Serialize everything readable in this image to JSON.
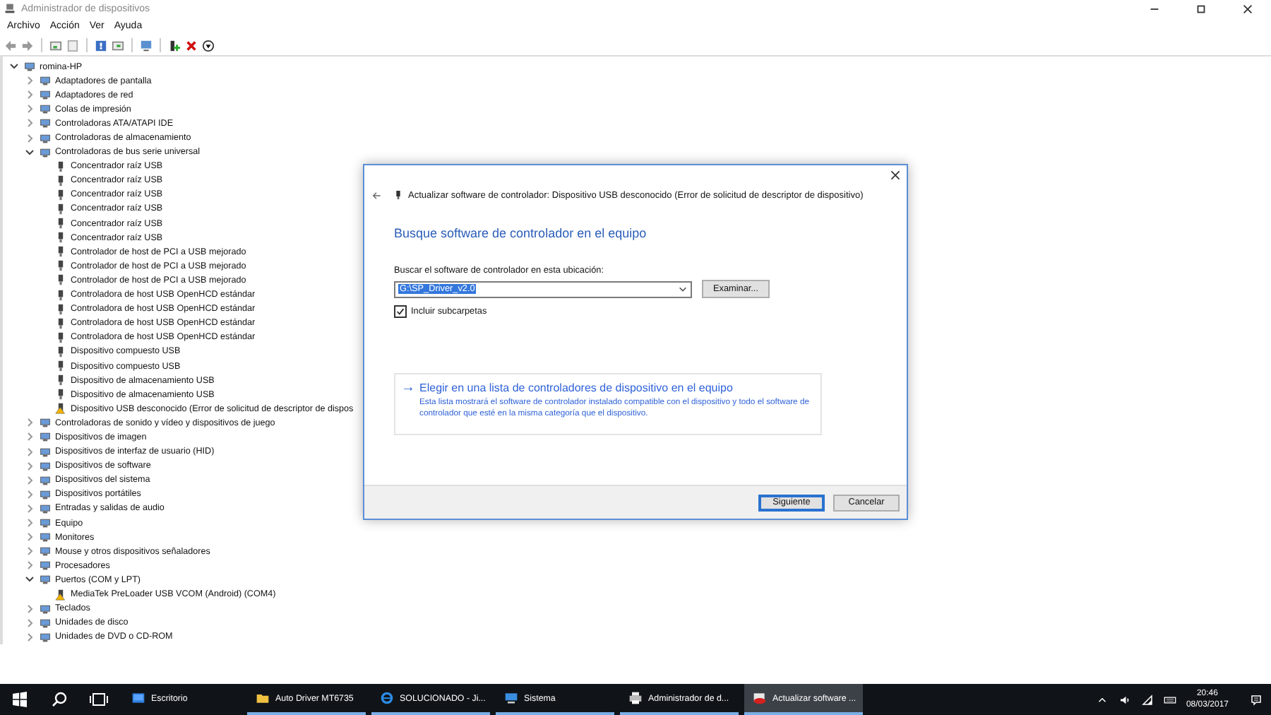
{
  "window": {
    "title": "Administrador de dispositivos"
  },
  "menu": [
    "Archivo",
    "Acción",
    "Ver",
    "Ayuda"
  ],
  "tree": {
    "label": "romina-HP",
    "expanded": true,
    "children": [
      {
        "label": "Adaptadores de pantalla",
        "expanded": false
      },
      {
        "label": "Adaptadores de red",
        "expanded": false
      },
      {
        "label": "Colas de impresión",
        "expanded": false
      },
      {
        "label": "Controladoras ATA/ATAPI IDE",
        "expanded": false
      },
      {
        "label": "Controladoras de almacenamiento",
        "expanded": false
      },
      {
        "label": "Controladoras de bus serie universal",
        "expanded": true,
        "children": [
          {
            "label": "Concentrador raíz USB",
            "warning": false
          },
          {
            "label": "Concentrador raíz USB",
            "warning": false
          },
          {
            "label": "Concentrador raíz USB",
            "warning": false
          },
          {
            "label": "Concentrador raíz USB",
            "warning": false
          },
          {
            "label": "Concentrador raíz USB",
            "warning": false
          },
          {
            "label": "Concentrador raíz USB",
            "warning": false
          },
          {
            "label": "Controlador de host de PCI a USB mejorado",
            "warning": false
          },
          {
            "label": "Controlador de host de PCI a USB mejorado",
            "warning": false
          },
          {
            "label": "Controlador de host de PCI a USB mejorado",
            "warning": false
          },
          {
            "label": "Controladora de host USB OpenHCD estándar",
            "warning": false
          },
          {
            "label": "Controladora de host USB OpenHCD estándar",
            "warning": false
          },
          {
            "label": "Controladora de host USB OpenHCD estándar",
            "warning": false
          },
          {
            "label": "Controladora de host USB OpenHCD estándar",
            "warning": false
          },
          {
            "label": "Dispositivo compuesto USB",
            "warning": false
          },
          {
            "label": "Dispositivo compuesto USB",
            "warning": false
          },
          {
            "label": "Dispositivo de almacenamiento USB",
            "warning": false
          },
          {
            "label": "Dispositivo de almacenamiento USB",
            "warning": false
          },
          {
            "label": "Dispositivo USB desconocido (Error de solicitud de descriptor de dispos",
            "warning": true
          }
        ]
      },
      {
        "label": "Controladoras de sonido y vídeo y dispositivos de juego",
        "expanded": false
      },
      {
        "label": "Dispositivos de imagen",
        "expanded": false
      },
      {
        "label": "Dispositivos de interfaz de usuario (HID)",
        "expanded": false
      },
      {
        "label": "Dispositivos de software",
        "expanded": false
      },
      {
        "label": "Dispositivos del sistema",
        "expanded": false
      },
      {
        "label": "Dispositivos portátiles",
        "expanded": false
      },
      {
        "label": "Entradas y salidas de audio",
        "expanded": false
      },
      {
        "label": "Equipo",
        "expanded": false
      },
      {
        "label": "Monitores",
        "expanded": false
      },
      {
        "label": "Mouse y otros dispositivos señaladores",
        "expanded": false
      },
      {
        "label": "Procesadores",
        "expanded": false
      },
      {
        "label": "Puertos (COM y LPT)",
        "expanded": true,
        "children": [
          {
            "label": "MediaTek PreLoader USB VCOM (Android) (COM4)",
            "warning": true
          }
        ]
      },
      {
        "label": "Teclados",
        "expanded": false
      },
      {
        "label": "Unidades de disco",
        "expanded": false
      },
      {
        "label": "Unidades de DVD o CD-ROM",
        "expanded": false
      }
    ]
  },
  "dialog": {
    "title": "Actualizar software de controlador: Dispositivo USB desconocido (Error de solicitud de descriptor de dispositivo)",
    "heading": "Busque software de controlador en el equipo",
    "location_label": "Buscar el software de controlador en esta ubicación:",
    "path": {
      "value": "G:\\SP_Driver_v2.0",
      "selected": true
    },
    "browse_button": "Examinar...",
    "include_subfolders": {
      "label": "Incluir subcarpetas",
      "checked": true
    },
    "option": {
      "arrow": "→",
      "title": "Elegir en una lista de controladores de dispositivo en el equipo",
      "description": "Esta lista mostrará el software de controlador instalado compatible con el dispositivo y todo el software de controlador que esté en la misma categoría que el dispositivo."
    },
    "buttons": [
      {
        "label": "Siguiente",
        "default": true
      },
      {
        "label": "Cancelar",
        "default": false
      }
    ]
  },
  "taskbar": {
    "tasks": [
      {
        "label": "Escritorio",
        "kind": "desktop",
        "selected": false,
        "running": false
      },
      {
        "label": "Auto Driver MT6735",
        "kind": "folder",
        "selected": false,
        "running": true
      },
      {
        "label": "SOLUCIONADO - Ji...",
        "kind": "browser",
        "selected": false,
        "running": true
      },
      {
        "label": "Sistema",
        "kind": "system",
        "selected": false,
        "running": true
      },
      {
        "label": "Administrador de d...",
        "kind": "manager",
        "selected": false,
        "running": true
      },
      {
        "label": "Actualizar software ...",
        "kind": "update",
        "selected": true,
        "running": true
      }
    ],
    "time": "20:46",
    "date": "08/03/2017"
  }
}
